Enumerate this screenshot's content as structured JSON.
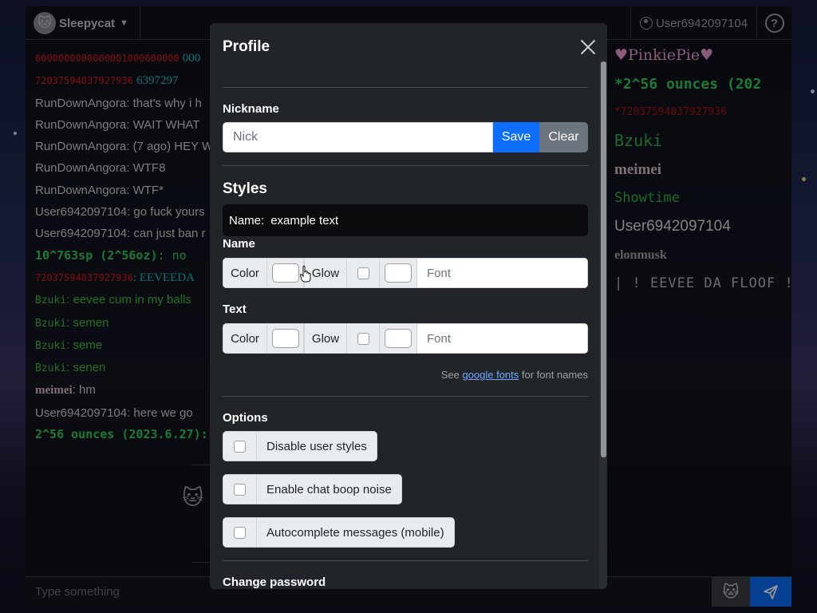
{
  "app": {
    "brand": "Sleepycat",
    "username": "User6942097104",
    "help_glyph": "?",
    "message_placeholder": "Type something",
    "colors": {
      "accent": "#0d6efd",
      "green_name": "#2ed35a",
      "red_name": "#e01818"
    }
  },
  "chat": {
    "messages": [
      {
        "name": "RunDownAngora",
        "text": ": that's why i h"
      },
      {
        "name": "RunDownAngora",
        "text": ": WAIT WHAT"
      },
      {
        "name": "RunDownAngora",
        "text": ": (7 ago) HEY W"
      },
      {
        "name": "RunDownAngora",
        "text": ": WTF8"
      },
      {
        "name": "RunDownAngora",
        "text": ": WTF*"
      },
      {
        "name": "User6942097104",
        "text": ": go fuck yours"
      },
      {
        "name": "User6942097104",
        "text": ": can just ban r"
      },
      {
        "name": "10^763sp (2^56oz)",
        "text": ": no"
      },
      {
        "name": "72037594037927936",
        "text": ": EEVEEDA"
      },
      {
        "name": "Bzuki",
        "text": ": eevee cum in my balls"
      },
      {
        "name": "Bzuki",
        "text": ": semen"
      },
      {
        "name": "Bzuki",
        "text": ": seme"
      },
      {
        "name": "Bzuki",
        "text": ": senen"
      },
      {
        "name": "meimei",
        "text": ": hm"
      },
      {
        "name": "User6942097104",
        "text": ": here we go"
      },
      {
        "name": "2^56 ounces (2023.6.27)",
        "text": ":"
      }
    ],
    "top_partial_1": "0000000000000001000000000",
    "top_partial_1_tail": "000",
    "top_partial_2": "72037594037927936",
    "top_partial_2_tail": "6397297"
  },
  "userlist": [
    "♥PinkiePie♥",
    "*2^56 ounces (202",
    "*72037594037927936",
    "Bzuki",
    "meimei",
    "Showtime",
    "User6942097104",
    "elonmusk",
    "| ! EEVEE DA FLOOF !"
  ],
  "profile": {
    "title": "Profile",
    "nickname_label": "Nickname",
    "nickname_placeholder": "Nick",
    "save_label": "Save",
    "clear_label": "Clear",
    "styles_title": "Styles",
    "preview_name": "Name:",
    "preview_text": "example text",
    "name_label": "Name",
    "text_label": "Text",
    "color_label": "Color",
    "glow_label": "Glow",
    "font_placeholder": "Font",
    "hint_prefix": "See ",
    "hint_link": "google fonts",
    "hint_suffix": " for font names",
    "options_label": "Options",
    "options": [
      "Disable user styles",
      "Enable chat boop noise",
      "Autocomplete messages (mobile)"
    ],
    "change_password_label": "Change password"
  }
}
